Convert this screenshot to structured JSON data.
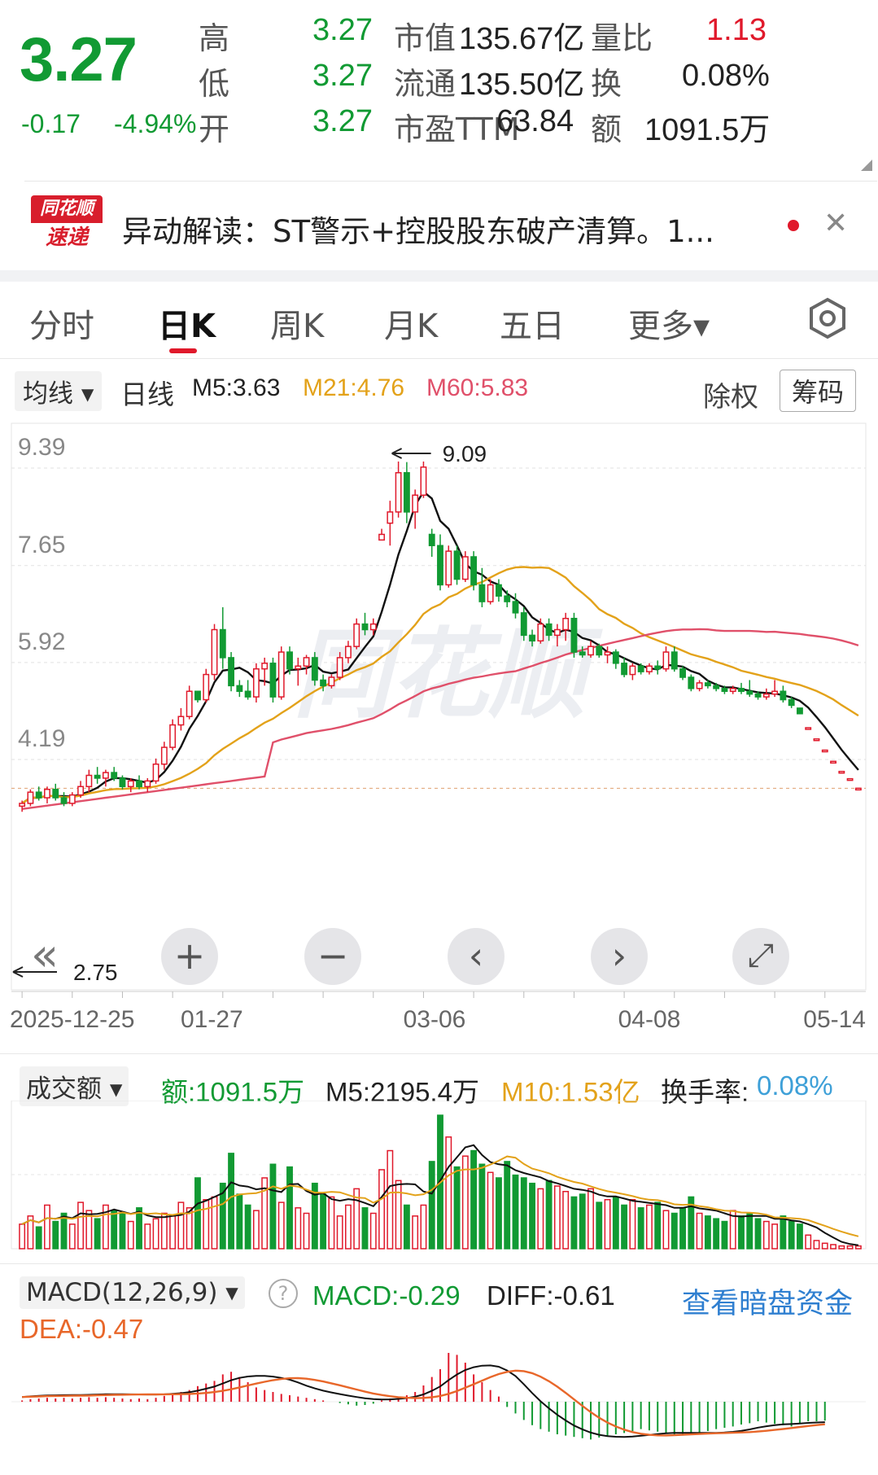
{
  "quote": {
    "price": "3.27",
    "change": "-0.17",
    "change_pct": "-4.94%",
    "rows": [
      {
        "l1": "高",
        "v1": "3.27",
        "l2": "市值",
        "v2": "135.67亿",
        "l3": "量比",
        "v3": "1.13"
      },
      {
        "l1": "低",
        "v1": "3.27",
        "l2": "流通",
        "v2": "135.50亿",
        "l3": "换",
        "v3": "0.08%"
      },
      {
        "l1": "开",
        "v1": "3.27",
        "l2": "市盈TTM",
        "v2": "63.84",
        "l3": "额",
        "v3": "1091.5万"
      }
    ]
  },
  "news": {
    "logo_top": "同花顺",
    "logo_bottom": "速递",
    "text": "异动解读：ST警示+控股股东破产清算。1..."
  },
  "tabs": [
    "分时",
    "日K",
    "周K",
    "月K",
    "五日",
    "更多▾"
  ],
  "indicator_bar": {
    "ma_select": "均线 ▾",
    "period": "日线",
    "m5": "M5:3.63",
    "m21": "M21:4.76",
    "m60": "M60:5.83",
    "chuquan": "除权",
    "chouma": "筹码"
  },
  "colors": {
    "up": "#e0192b",
    "down": "#119a33",
    "m5": "#111111",
    "m21": "#e3a21a",
    "m60": "#e0506a",
    "link": "#2f7fd0"
  },
  "chart_data": [
    {
      "type": "candlestick",
      "yticks": [
        "9.39",
        "7.65",
        "5.92",
        "4.19"
      ],
      "xticks": [
        "2025-12-25",
        "01-27",
        "03-06",
        "04-08",
        "05-14"
      ],
      "annotations": {
        "high": "9.09",
        "low": "2.75"
      },
      "watermark": "同花顺",
      "ohlc": [
        [
          2.95,
          3.05,
          2.85,
          3.0
        ],
        [
          3.0,
          3.25,
          2.95,
          3.2
        ],
        [
          3.2,
          3.3,
          3.05,
          3.1
        ],
        [
          3.1,
          3.3,
          3.0,
          3.25
        ],
        [
          3.25,
          3.35,
          3.05,
          3.1
        ],
        [
          3.1,
          3.2,
          2.95,
          3.0
        ],
        [
          3.0,
          3.2,
          2.95,
          3.15
        ],
        [
          3.15,
          3.4,
          3.1,
          3.3
        ],
        [
          3.3,
          3.6,
          3.2,
          3.5
        ],
        [
          3.5,
          3.65,
          3.35,
          3.45
        ],
        [
          3.45,
          3.6,
          3.3,
          3.55
        ],
        [
          3.55,
          3.65,
          3.4,
          3.45
        ],
        [
          3.45,
          3.5,
          3.25,
          3.3
        ],
        [
          3.3,
          3.45,
          3.2,
          3.4
        ],
        [
          3.4,
          3.5,
          3.25,
          3.3
        ],
        [
          3.3,
          3.45,
          3.2,
          3.4
        ],
        [
          3.4,
          3.8,
          3.35,
          3.7
        ],
        [
          3.7,
          4.1,
          3.6,
          4.0
        ],
        [
          4.0,
          4.5,
          3.95,
          4.4
        ],
        [
          4.4,
          4.7,
          4.3,
          4.55
        ],
        [
          4.55,
          5.1,
          4.5,
          5.0
        ],
        [
          5.0,
          5.0,
          4.8,
          4.85
        ],
        [
          4.85,
          5.4,
          4.8,
          5.3
        ],
        [
          5.3,
          6.2,
          5.2,
          6.1
        ],
        [
          6.1,
          6.5,
          5.4,
          5.6
        ],
        [
          5.6,
          5.7,
          5.0,
          5.1
        ],
        [
          5.1,
          5.2,
          4.9,
          5.0
        ],
        [
          5.0,
          5.2,
          4.85,
          4.9
        ],
        [
          4.9,
          5.5,
          4.8,
          5.4
        ],
        [
          5.4,
          5.6,
          5.1,
          5.5
        ],
        [
          5.5,
          5.6,
          4.8,
          4.9
        ],
        [
          4.9,
          5.8,
          4.85,
          5.7
        ],
        [
          5.7,
          5.8,
          5.3,
          5.4
        ],
        [
          5.4,
          5.6,
          5.1,
          5.45
        ],
        [
          5.45,
          5.65,
          5.3,
          5.6
        ],
        [
          5.6,
          5.7,
          5.1,
          5.2
        ],
        [
          5.2,
          5.3,
          5.0,
          5.1
        ],
        [
          5.1,
          5.3,
          5.05,
          5.25
        ],
        [
          5.25,
          5.7,
          5.2,
          5.6
        ],
        [
          5.6,
          5.9,
          5.5,
          5.8
        ],
        [
          5.8,
          6.3,
          5.75,
          6.2
        ],
        [
          6.2,
          6.4,
          6.0,
          6.1
        ],
        [
          6.1,
          6.3,
          6.0,
          6.2
        ],
        [
          7.7,
          7.9,
          7.7,
          7.8
        ],
        [
          8.0,
          8.4,
          7.6,
          8.2
        ],
        [
          8.2,
          9.1,
          8.1,
          8.9
        ],
        [
          8.9,
          9.09,
          8.0,
          8.2
        ],
        [
          8.2,
          8.6,
          7.9,
          8.5
        ],
        [
          8.5,
          9.1,
          8.45,
          9.0
        ],
        [
          7.8,
          7.9,
          7.4,
          7.6
        ],
        [
          7.6,
          7.8,
          6.8,
          6.9
        ],
        [
          6.9,
          7.6,
          6.85,
          7.5
        ],
        [
          7.5,
          7.6,
          6.9,
          7.0
        ],
        [
          7.0,
          7.5,
          6.95,
          7.4
        ],
        [
          7.4,
          7.5,
          6.8,
          6.9
        ],
        [
          6.9,
          7.2,
          6.5,
          6.6
        ],
        [
          6.6,
          7.0,
          6.55,
          6.9
        ],
        [
          6.9,
          7.0,
          6.6,
          6.7
        ],
        [
          6.7,
          6.8,
          6.5,
          6.6
        ],
        [
          6.6,
          6.75,
          6.3,
          6.4
        ],
        [
          6.4,
          6.5,
          5.9,
          6.0
        ],
        [
          6.0,
          6.1,
          5.8,
          5.9
        ],
        [
          5.9,
          6.3,
          5.85,
          6.2
        ],
        [
          6.2,
          6.3,
          5.9,
          6.0
        ],
        [
          6.0,
          6.2,
          5.8,
          6.1
        ],
        [
          6.1,
          6.4,
          5.9,
          6.3
        ],
        [
          6.3,
          6.4,
          5.6,
          5.7
        ],
        [
          5.7,
          5.8,
          5.6,
          5.65
        ],
        [
          5.65,
          5.9,
          5.6,
          5.8
        ],
        [
          5.8,
          5.85,
          5.6,
          5.65
        ],
        [
          5.65,
          5.8,
          5.5,
          5.7
        ],
        [
          5.7,
          5.75,
          5.4,
          5.5
        ],
        [
          5.5,
          5.6,
          5.25,
          5.3
        ],
        [
          5.3,
          5.5,
          5.2,
          5.45
        ],
        [
          5.45,
          5.5,
          5.3,
          5.35
        ],
        [
          5.35,
          5.5,
          5.3,
          5.45
        ],
        [
          5.45,
          5.55,
          5.3,
          5.4
        ],
        [
          5.4,
          5.8,
          5.35,
          5.7
        ],
        [
          5.7,
          5.8,
          5.35,
          5.4
        ],
        [
          5.4,
          5.45,
          5.2,
          5.25
        ],
        [
          5.25,
          5.3,
          5.0,
          5.05
        ],
        [
          5.05,
          5.2,
          5.0,
          5.15
        ],
        [
          5.15,
          5.2,
          5.05,
          5.1
        ],
        [
          5.1,
          5.15,
          5.0,
          5.05
        ],
        [
          5.05,
          5.1,
          4.95,
          5.0
        ],
        [
          5.0,
          5.1,
          4.95,
          5.05
        ],
        [
          5.05,
          5.15,
          4.95,
          5.0
        ],
        [
          5.0,
          5.2,
          4.9,
          4.95
        ],
        [
          4.95,
          5.0,
          4.85,
          4.9
        ],
        [
          4.9,
          5.05,
          4.85,
          4.95
        ],
        [
          4.95,
          5.2,
          4.9,
          5.0
        ],
        [
          5.0,
          5.1,
          4.8,
          4.85
        ],
        [
          4.85,
          4.9,
          4.7,
          4.75
        ],
        [
          4.7,
          4.7,
          4.6,
          4.6
        ],
        [
          4.35,
          4.35,
          4.35,
          4.35
        ],
        [
          4.15,
          4.15,
          4.15,
          4.15
        ],
        [
          3.95,
          3.95,
          3.95,
          3.95
        ],
        [
          3.75,
          3.75,
          3.75,
          3.75
        ],
        [
          3.57,
          3.57,
          3.57,
          3.57
        ],
        [
          3.44,
          3.44,
          3.44,
          3.44
        ],
        [
          3.27,
          3.27,
          3.27,
          3.27
        ]
      ]
    },
    {
      "type": "bar",
      "title": "成交额",
      "labels": {
        "amount": "额:1091.5万",
        "m5": "M5:2195.4万",
        "m10": "M10:1.53亿",
        "turnover_label": "换手率:",
        "turnover": "0.08%"
      },
      "values_yi": [
        0.9,
        1.2,
        0.8,
        1.6,
        1.0,
        1.3,
        0.9,
        1.7,
        1.4,
        1.1,
        1.6,
        1.4,
        1.3,
        1.0,
        1.5,
        0.9,
        1.1,
        1.3,
        1.2,
        1.7,
        1.5,
        2.6,
        1.8,
        1.9,
        2.4,
        3.5,
        2.0,
        1.6,
        1.4,
        2.6,
        3.1,
        1.7,
        3.0,
        1.5,
        1.3,
        2.4,
        2.0,
        1.9,
        1.2,
        1.6,
        2.2,
        1.5,
        1.3,
        2.9,
        3.6,
        2.5,
        1.6,
        1.2,
        1.6,
        3.2,
        4.9,
        4.1,
        3.0,
        3.4,
        3.6,
        3.1,
        2.8,
        2.6,
        3.2,
        2.7,
        2.6,
        2.4,
        2.2,
        2.5,
        2.3,
        2.1,
        1.9,
        2.0,
        2.2,
        1.7,
        1.8,
        1.9,
        1.6,
        1.8,
        1.5,
        1.6,
        1.7,
        1.4,
        1.3,
        1.5,
        1.9,
        1.3,
        1.2,
        1.1,
        1.0,
        1.4,
        1.2,
        1.3,
        1.1,
        1.0,
        0.9,
        1.2,
        1.0,
        0.9,
        0.5,
        0.3,
        0.2,
        0.15,
        0.1,
        0.1,
        0.1
      ]
    },
    {
      "type": "bar",
      "title": "MACD(12,26,9)",
      "labels": {
        "macd": "MACD:-0.29",
        "diff": "DIFF:-0.61",
        "dea": "DEA:-0.47",
        "link": "查看暗盘资金"
      },
      "hist": [
        0.02,
        0.04,
        0.05,
        0.06,
        0.05,
        0.06,
        0.05,
        0.06,
        0.07,
        0.06,
        0.07,
        0.06,
        0.05,
        0.04,
        0.05,
        0.04,
        0.06,
        0.09,
        0.12,
        0.15,
        0.18,
        0.24,
        0.28,
        0.32,
        0.42,
        0.46,
        0.38,
        0.3,
        0.22,
        0.18,
        0.15,
        0.12,
        0.1,
        0.08,
        0.06,
        0.04,
        0.02,
        0,
        -0.02,
        -0.04,
        -0.06,
        -0.05,
        -0.03,
        0.02,
        0.05,
        0.08,
        0.1,
        0.15,
        0.25,
        0.38,
        0.5,
        0.75,
        0.72,
        0.6,
        0.42,
        0.3,
        0.18,
        0.08,
        -0.08,
        -0.18,
        -0.28,
        -0.36,
        -0.42,
        -0.46,
        -0.5,
        -0.52,
        -0.54,
        -0.56,
        -0.58,
        -0.55,
        -0.52,
        -0.5,
        -0.48,
        -0.45,
        -0.42,
        -0.44,
        -0.46,
        -0.48,
        -0.5,
        -0.52,
        -0.5,
        -0.48,
        -0.45,
        -0.42,
        -0.4,
        -0.38,
        -0.35,
        -0.33,
        -0.3,
        -0.32,
        -0.34,
        -0.36,
        -0.38,
        -0.34,
        -0.3,
        -0.3,
        -0.29
      ]
    }
  ],
  "controls": {
    "fast": "«",
    "zoom_in": "+",
    "zoom_out": "−",
    "prev": "‹",
    "next": "›",
    "fullscreen": "⤢"
  }
}
